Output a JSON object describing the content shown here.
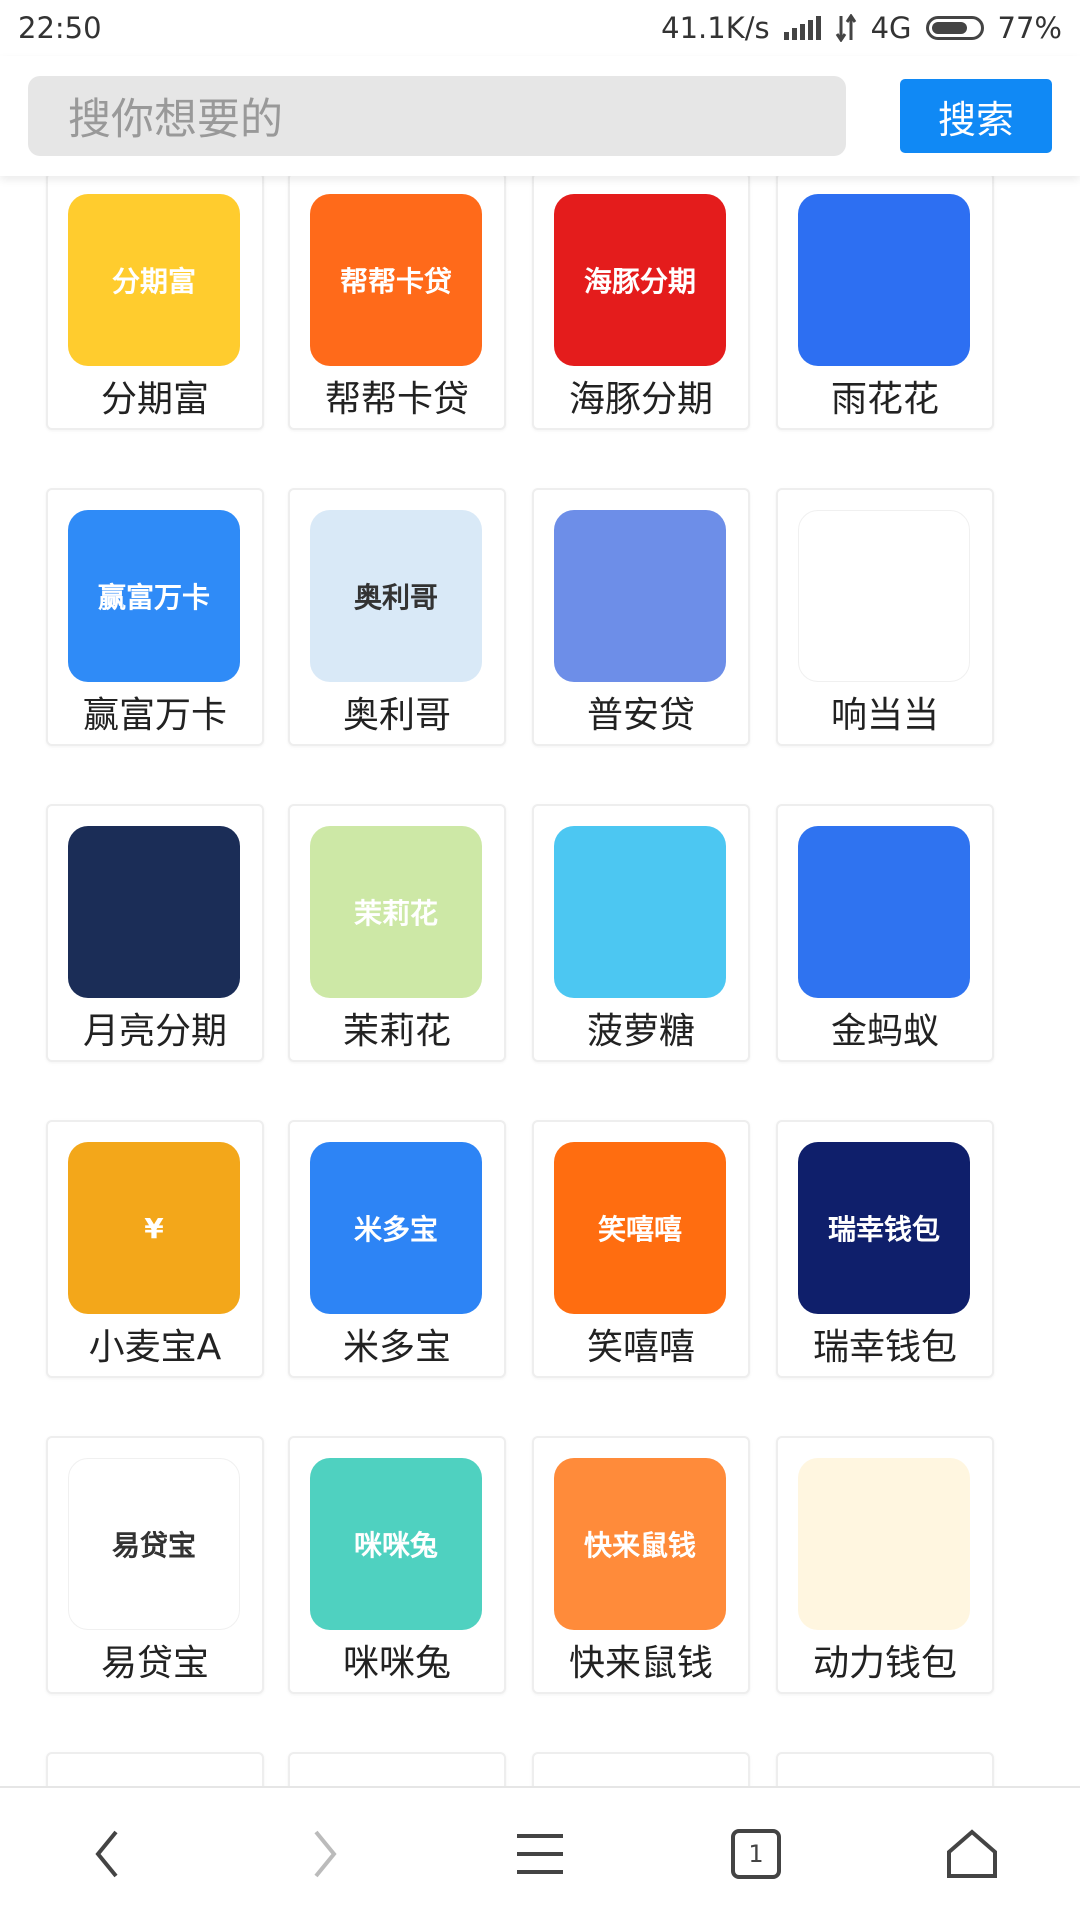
{
  "status_bar": {
    "time": "22:50",
    "network_speed": "41.1K/s",
    "network_type": "4G",
    "battery": "77%"
  },
  "search": {
    "placeholder": "搜你想要的",
    "button_label": "搜索"
  },
  "apps": [
    {
      "label": "分期富",
      "icon_text": "分期富",
      "color": "#ffcc2e",
      "icon": "chicken-icon"
    },
    {
      "label": "帮帮卡贷",
      "icon_text": "帮帮卡贷",
      "color": "#ff6a1a",
      "icon": "card-icon"
    },
    {
      "label": "海豚分期",
      "icon_text": "海豚分期",
      "color": "#e41c1c",
      "icon": "dolphin-icon"
    },
    {
      "label": "雨花花",
      "icon_text": "",
      "color": "#2d6ff2",
      "icon": "lotus-icon"
    },
    {
      "label": "赢富万卡",
      "icon_text": "赢富万卡",
      "color": "#2f8bf7",
      "icon": "wallet-icon"
    },
    {
      "label": "奥利哥",
      "icon_text": "奥利哥",
      "color": "#d9e9f7",
      "icon": "portrait-icon"
    },
    {
      "label": "普安贷",
      "icon_text": "",
      "color": "#6d8ee8",
      "icon": "person-icon"
    },
    {
      "label": "响当当",
      "icon_text": "",
      "color": "#ffffff",
      "icon": "sparkle-icon"
    },
    {
      "label": "月亮分期",
      "icon_text": "",
      "color": "#1b2d57",
      "icon": "moon-icon"
    },
    {
      "label": "茉莉花",
      "icon_text": "茉莉花",
      "color": "#cde8a6",
      "icon": "flower-icon"
    },
    {
      "label": "菠萝糖",
      "icon_text": "",
      "color": "#4cc7f2",
      "icon": "pineapple-icon"
    },
    {
      "label": "金蚂蚁",
      "icon_text": "",
      "color": "#2f73f0",
      "icon": "ant-icon"
    },
    {
      "label": "小麦宝A",
      "icon_text": "¥",
      "color": "#f3a71a",
      "icon": "wheat-icon"
    },
    {
      "label": "米多宝",
      "icon_text": "米多宝",
      "color": "#2d84f5",
      "icon": "pig-icon"
    },
    {
      "label": "笑嘻嘻",
      "icon_text": "笑嘻嘻",
      "color": "#ff6d10",
      "icon": "god-of-wealth-icon"
    },
    {
      "label": "瑞幸钱包",
      "icon_text": "瑞幸钱包",
      "color": "#0f1f6b",
      "icon": "deer-icon"
    },
    {
      "label": "易贷宝",
      "icon_text": "易贷宝",
      "color": "#ffffff",
      "icon": "fruit-icon"
    },
    {
      "label": "咪咪兔",
      "icon_text": "咪咪兔",
      "color": "#4fd1c0",
      "icon": "rabbit-icon"
    },
    {
      "label": "快来鼠钱",
      "icon_text": "快来鼠钱",
      "color": "#ff8b3a",
      "icon": "mouse-icon"
    },
    {
      "label": "动力钱包",
      "icon_text": "",
      "color": "#fff6e0",
      "icon": "red-envelope-icon"
    }
  ],
  "bottom_nav": {
    "tab_count": "1"
  }
}
